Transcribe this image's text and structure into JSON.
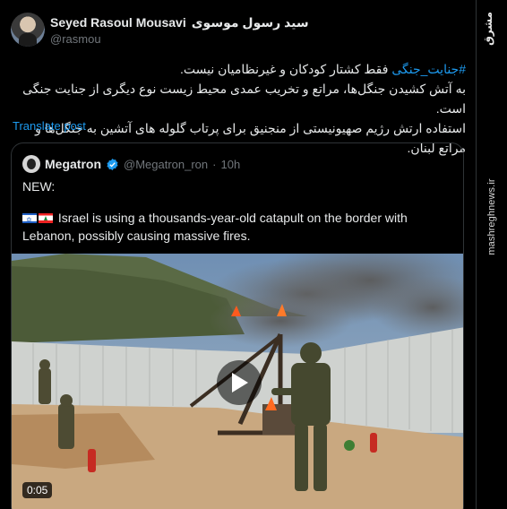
{
  "author": {
    "display_name": "Seyed Rasoul Mousavi",
    "display_name_fa": "سید رسول موسوی",
    "handle": "@rasmou",
    "avatar_icon": "profile-photo"
  },
  "tweet": {
    "hashtag": "#جنایت_جنگی",
    "line1_rest": " فقط کشتار کودکان و غیرنظامیان نیست.",
    "line2": "به آتش کشیدن جنگل‌ها، مراتع و تخریب عمدی محیط زیست نوع دیگری از جنایت جنگی است.",
    "line3": "استفاده ارتش رژیم صهیونیستی از منجنیق برای پرتاب گلوله های آتشین به جنگل‌ها و مراتع لبنان."
  },
  "translate_label": "Translate post",
  "quoted": {
    "display_name": "Megatron",
    "verified_icon": "verified-badge-icon",
    "handle": "@Megatron_ron",
    "separator": "·",
    "time": "10h",
    "line1": "NEW:",
    "flags": [
      "israel-flag",
      "lebanon-flag"
    ],
    "body": " Israel is using a thousands-year-old catapult on the border with Lebanon, possibly causing massive fires.",
    "video": {
      "play_icon": "play-icon",
      "duration": "0:05"
    }
  },
  "watermark": {
    "logo_text": "مشرق",
    "url": "mashreghnews.ir"
  },
  "colors": {
    "background": "#000000",
    "text": "#e7e9ea",
    "muted": "#71767b",
    "link": "#1d9bf0",
    "border": "#2f3336"
  }
}
